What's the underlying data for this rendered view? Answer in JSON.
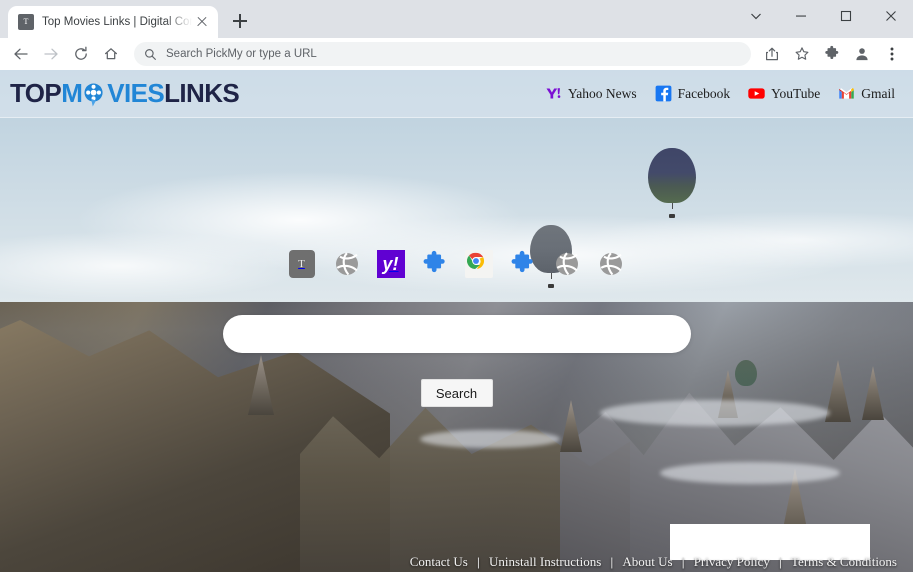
{
  "browser": {
    "tab": {
      "title": "Top Movies Links | Digital Conten",
      "favicon_letter": "T",
      "close_label": "Close tab"
    },
    "new_tab_label": "New Tab",
    "window_controls": {
      "search_tabs": "Search tabs",
      "minimize": "Minimize",
      "maximize": "Maximize",
      "close": "Close"
    },
    "toolbar": {
      "back": "Back",
      "forward": "Forward",
      "reload": "Reload",
      "home": "Home",
      "omnibox_placeholder": "Search PickMy or type a URL",
      "omnibox_value": "",
      "share": "Share this page",
      "bookmark": "Bookmark this tab",
      "extensions": "Extensions",
      "profile": "Profile",
      "menu": "Customize and control Google Chrome"
    }
  },
  "site": {
    "logo": {
      "part1": "TOP",
      "part2": "M",
      "part3": "VIES",
      "part4": "LINKS",
      "reel_icon": "film-reel-icon",
      "color_dark": "#1f2447",
      "color_blue": "#2186d6"
    },
    "header_links": [
      {
        "label": "Yahoo News",
        "icon": "yahoo-icon",
        "color": "#6001d2"
      },
      {
        "label": "Facebook",
        "icon": "facebook-icon",
        "color": "#1877f2"
      },
      {
        "label": "YouTube",
        "icon": "youtube-icon",
        "color": "#ff0000"
      },
      {
        "label": "Gmail",
        "icon": "gmail-icon",
        "color": "#ea4335"
      }
    ],
    "shortcuts": [
      {
        "name": "shortcut-t",
        "icon": "letter-t-icon",
        "label": "T"
      },
      {
        "name": "shortcut-globe-1",
        "icon": "globe-icon",
        "label": ""
      },
      {
        "name": "shortcut-yahoo",
        "icon": "yahoo-icon",
        "label": "y!"
      },
      {
        "name": "shortcut-puzzle-1",
        "icon": "puzzle-piece-icon",
        "label": ""
      },
      {
        "name": "shortcut-chrome",
        "icon": "chrome-icon",
        "label": ""
      },
      {
        "name": "shortcut-puzzle-2",
        "icon": "puzzle-piece-icon",
        "label": ""
      },
      {
        "name": "shortcut-globe-2",
        "icon": "globe-icon",
        "label": ""
      },
      {
        "name": "shortcut-globe-3",
        "icon": "globe-icon",
        "label": ""
      }
    ],
    "search": {
      "value": "",
      "placeholder": "",
      "button_label": "Search"
    },
    "footer_links": [
      "Contact Us",
      "Uninstall Instructions",
      "About Us",
      "Privacy Policy",
      "Terms & Conditions"
    ],
    "footer_separator": "|",
    "ad_panel_label": ""
  },
  "background": {
    "description": "Winter Cappadocia rock-formation landscape with hot air balloons",
    "balloons": [
      {
        "name": "balloon-large",
        "colors": [
          "#3f4668",
          "#556b4f"
        ]
      },
      {
        "name": "balloon-grey",
        "colors": [
          "#6f757c",
          "#5d636b"
        ]
      },
      {
        "name": "balloon-distant",
        "colors": [
          "#4d6151",
          "#456052"
        ]
      }
    ]
  }
}
